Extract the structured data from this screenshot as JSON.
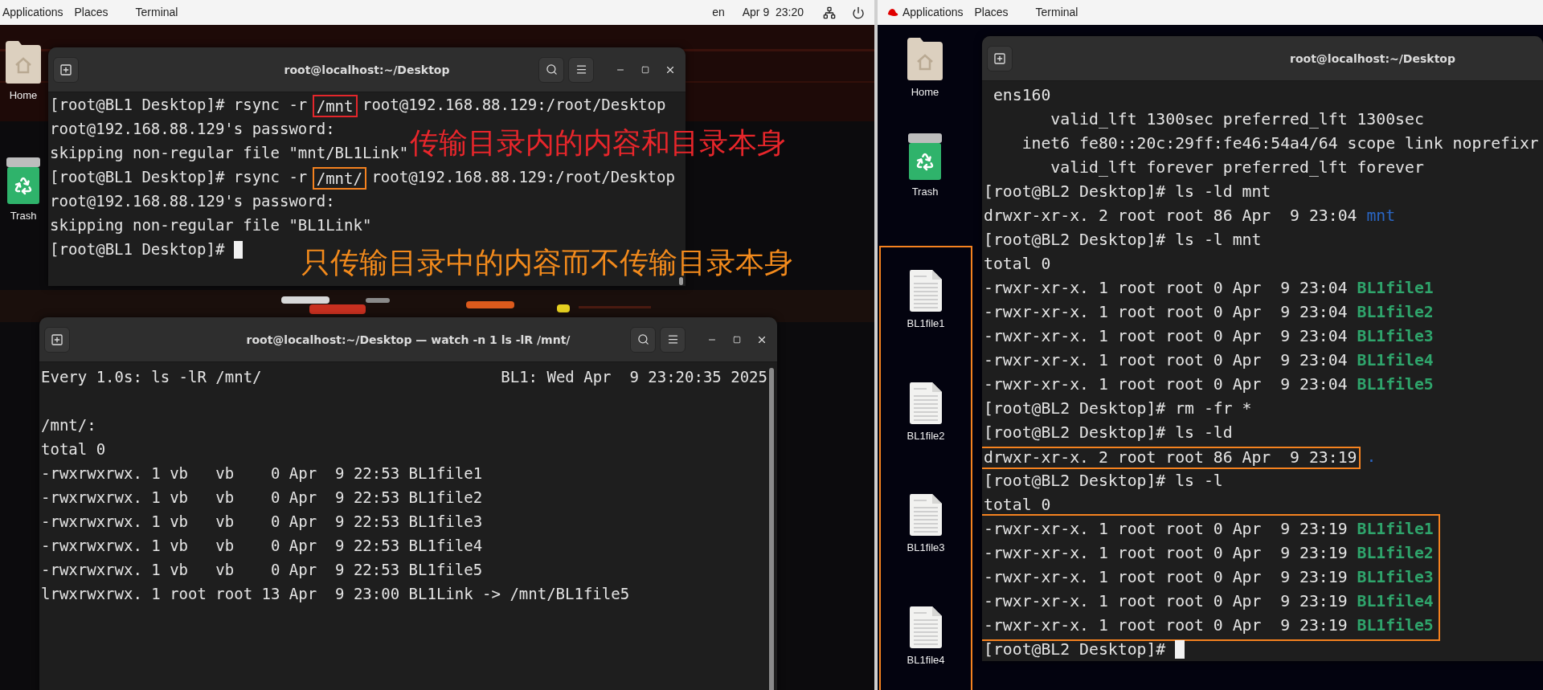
{
  "left_screen": {
    "top_bar": {
      "menus": [
        "Applications",
        "Places",
        "Terminal"
      ],
      "input_source": "en",
      "clock": "Apr 9  23:20"
    },
    "desktop_icons": [
      {
        "label": "Home",
        "kind": "home"
      },
      {
        "label": "Trash",
        "kind": "trash"
      }
    ],
    "terminals": [
      {
        "title": "root@localhost:~/Desktop",
        "blocks": [
          {
            "lines": [
              [
                {
                  "text": "[root@BL1 Desktop]# rsync -r ",
                  "kind": "plain"
                },
                {
                  "text": "/mnt",
                  "kind": "plain",
                  "color": "#e3262b"
                },
                {
                  "text": " root@192.168.88.129:/root/Desktop",
                  "kind": "plain"
                }
              ],
              [
                {
                  "text": "root@192.168.88.129's password:",
                  "kind": "plain"
                }
              ],
              [
                {
                  "text": "skipping non-regular file \"mnt/BL1Link\"",
                  "kind": "plain"
                }
              ],
              [
                {
                  "text": "[root@BL1 Desktop]# rsync -r ",
                  "kind": "plain"
                },
                {
                  "text": "/mnt/",
                  "kind": "plain",
                  "color": "#f5821f"
                },
                {
                  "text": " root@192.168.88.129:/root/Desktop",
                  "kind": "plain"
                }
              ],
              [
                {
                  "text": "root@192.168.88.129's password:",
                  "kind": "plain"
                }
              ],
              [
                {
                  "text": "skipping non-regular file \"BL1Link\"",
                  "kind": "plain"
                }
              ],
              [
                {
                  "text": "[root@BL1 Desktop]# ",
                  "kind": "plain"
                },
                {
                  "kind": "cursor"
                }
              ]
            ]
          }
        ]
      },
      {
        "title": "root@localhost:~/Desktop — watch -n 1 ls -lR /mnt/",
        "header": {
          "command": "Every 1.0s: ls -lR /mnt/",
          "status": "BL1: Wed Apr  9 23:20:35 2025"
        },
        "blocks": [
          {
            "lines": [
              [
                {
                  "text": "/mnt/:",
                  "kind": "plain"
                }
              ],
              [
                {
                  "text": "total 0",
                  "kind": "plain"
                }
              ],
              [
                {
                  "text": "-rwxrwxrwx. 1 vb   vb    0 Apr  9 22:53 BL1file1",
                  "kind": "plain"
                }
              ],
              [
                {
                  "text": "-rwxrwxrwx. 1 vb   vb    0 Apr  9 22:53 BL1file2",
                  "kind": "plain"
                }
              ],
              [
                {
                  "text": "-rwxrwxrwx. 1 vb   vb    0 Apr  9 22:53 BL1file3",
                  "kind": "plain"
                }
              ],
              [
                {
                  "text": "-rwxrwxrwx. 1 vb   vb    0 Apr  9 22:53 BL1file4",
                  "kind": "plain"
                }
              ],
              [
                {
                  "text": "-rwxrwxrwx. 1 vb   vb    0 Apr  9 22:53 BL1file5",
                  "kind": "plain"
                }
              ],
              [
                {
                  "text": "lrwxrwxrwx. 1 root root 13 Apr  9 23:00 BL1Link -> /mnt/BL1file5",
                  "kind": "plain"
                }
              ]
            ]
          }
        ]
      }
    ],
    "annotations": [
      {
        "text": "传输目录内的内容和目录本身",
        "color": "#e8262b"
      },
      {
        "text": "只传输目录中的内容而不传输目录本身",
        "color": "#f28a1c"
      }
    ]
  },
  "right_screen": {
    "top_bar": {
      "menus": [
        "Applications",
        "Places",
        "Terminal"
      ]
    },
    "desktop_icons": [
      {
        "label": "Home",
        "kind": "home"
      },
      {
        "label": "Trash",
        "kind": "trash"
      }
    ],
    "desktop_files": {
      "color": "#f5821f",
      "items": [
        {
          "label": "BL1file1"
        },
        {
          "label": "BL1file2"
        },
        {
          "label": "BL1file3"
        },
        {
          "label": "BL1file4"
        }
      ]
    },
    "terminal": {
      "title": "root@localhost:~/Desktop",
      "blocks": [
        {
          "lines": [
            [
              {
                "text": " ens160",
                "kind": "plain"
              }
            ],
            [
              {
                "text": "       valid_lft 1300sec preferred_lft 1300sec",
                "kind": "plain"
              }
            ],
            [
              {
                "text": "    inet6 fe80::20c:29ff:fe46:54a4/64 scope link noprefixr",
                "kind": "plain"
              }
            ],
            [
              {
                "text": "       valid_lft forever preferred_lft forever",
                "kind": "plain"
              }
            ],
            [
              {
                "text": "[root@BL2 Desktop]# ls -ld mnt",
                "kind": "plain"
              }
            ],
            [
              {
                "text": "drwxr-xr-x. 2 root root 86 Apr  9 23:04 ",
                "kind": "plain"
              },
              {
                "text": "mnt",
                "kind": "dir"
              }
            ],
            [
              {
                "text": "[root@BL2 Desktop]# ls -l mnt",
                "kind": "plain"
              }
            ],
            [
              {
                "text": "total 0",
                "kind": "plain"
              }
            ],
            [
              {
                "text": "-rwxr-xr-x. 1 root root 0 Apr  9 23:04 ",
                "kind": "plain"
              },
              {
                "text": "BL1file1",
                "kind": "exec"
              }
            ],
            [
              {
                "text": "-rwxr-xr-x. 1 root root 0 Apr  9 23:04 ",
                "kind": "plain"
              },
              {
                "text": "BL1file2",
                "kind": "exec"
              }
            ],
            [
              {
                "text": "-rwxr-xr-x. 1 root root 0 Apr  9 23:04 ",
                "kind": "plain"
              },
              {
                "text": "BL1file3",
                "kind": "exec"
              }
            ],
            [
              {
                "text": "-rwxr-xr-x. 1 root root 0 Apr  9 23:04 ",
                "kind": "plain"
              },
              {
                "text": "BL1file4",
                "kind": "exec"
              }
            ],
            [
              {
                "text": "-rwxr-xr-x. 1 root root 0 Apr  9 23:04 ",
                "kind": "plain"
              },
              {
                "text": "BL1file5",
                "kind": "exec"
              }
            ],
            [
              {
                "text": "[root@BL2 Desktop]# rm -fr *",
                "kind": "plain"
              }
            ],
            [
              {
                "text": "[root@BL2 Desktop]# ls -ld",
                "kind": "plain"
              }
            ],
            [
              {
                "text": "drwxr-xr-x. 2 root root 86 Apr  9 23:19",
                "kind": "plain",
                "color": "#f5821f"
              },
              {
                "text": " .",
                "kind": "dir"
              }
            ],
            [
              {
                "text": "[root@BL2 Desktop]# ls -l",
                "kind": "plain"
              }
            ],
            [
              {
                "text": "total 0",
                "kind": "plain"
              }
            ]
          ]
        },
        {
          "color": "#f5821f",
          "lines": [
            [
              {
                "text": "-rwxr-xr-x. 1 root root 0 Apr  9 23:19 ",
                "kind": "plain"
              },
              {
                "text": "BL1file1",
                "kind": "exec"
              }
            ],
            [
              {
                "text": "-rwxr-xr-x. 1 root root 0 Apr  9 23:19 ",
                "kind": "plain"
              },
              {
                "text": "BL1file2",
                "kind": "exec"
              }
            ],
            [
              {
                "text": "-rwxr-xr-x. 1 root root 0 Apr  9 23:19 ",
                "kind": "plain"
              },
              {
                "text": "BL1file3",
                "kind": "exec"
              }
            ],
            [
              {
                "text": "-rwxr-xr-x. 1 root root 0 Apr  9 23:19 ",
                "kind": "plain"
              },
              {
                "text": "BL1file4",
                "kind": "exec"
              }
            ],
            [
              {
                "text": "-rwxr-xr-x. 1 root root 0 Apr  9 23:19 ",
                "kind": "plain"
              },
              {
                "text": "BL1file5",
                "kind": "exec"
              }
            ]
          ]
        },
        {
          "lines": [
            [
              {
                "text": "[root@BL2 Desktop]# ",
                "kind": "plain"
              },
              {
                "kind": "cursor"
              }
            ]
          ]
        }
      ]
    }
  }
}
